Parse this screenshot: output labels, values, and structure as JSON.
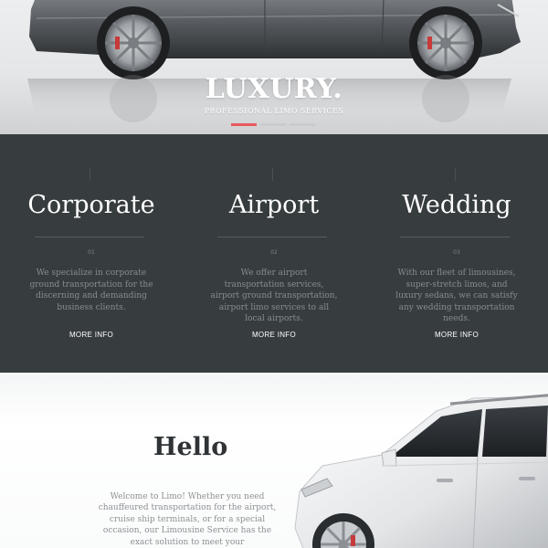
{
  "hero": {
    "title": "LUXURY.",
    "subtitle": "PROFESSIONAL LIMO SERVICES",
    "slides": [
      {
        "active": true
      },
      {
        "active": false
      },
      {
        "active": false
      }
    ],
    "accent_color": "#e75a5e"
  },
  "services": [
    {
      "number": "01",
      "title": "Corporate",
      "text": "We specialize in corporate ground transportation for the discerning and demanding business clients.",
      "link": "MORE INFO"
    },
    {
      "number": "02",
      "title": "Airport",
      "text": "We offer airport transportation services, airport ground transportation, airport limo services to all local airports.",
      "link": "MORE INFO"
    },
    {
      "number": "03",
      "title": "Wedding",
      "text": "With our fleet of limousines, super-stretch limos, and luxury sedans, we can satisfy any wedding transportation needs.",
      "link": "MORE INFO"
    }
  ],
  "about": {
    "heading": "Hello",
    "text": "Welcome to Limo! Whether you need chauffeured transportation for the airport, cruise ship terminals, or for a special occasion, our Limousine Service has the exact solution to meet your"
  },
  "colors": {
    "services_background": "#373c3f",
    "hero_background": "#e4e6e7",
    "heading_dark": "#2f3336"
  },
  "images": {
    "hero_car": "dark-gray-sedan",
    "about_car": "white-suv"
  }
}
